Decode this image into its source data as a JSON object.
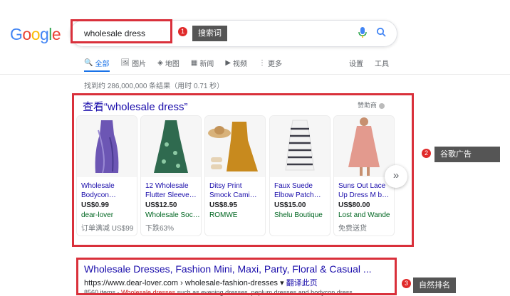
{
  "logo": [
    "G",
    "o",
    "o",
    "g",
    "l",
    "e"
  ],
  "search": {
    "query": "wholesale dress"
  },
  "annotations": {
    "search_term": "搜索词",
    "google_ads": "谷歌广告",
    "organic": "自然排名",
    "n1": "1",
    "n2": "2",
    "n3": "3"
  },
  "tabs": [
    {
      "label": "全部",
      "icon": "🔍"
    },
    {
      "label": "图片",
      "icon": "🖼"
    },
    {
      "label": "地图",
      "icon": "◈"
    },
    {
      "label": "新闻",
      "icon": "▦"
    },
    {
      "label": "视频",
      "icon": "▶"
    },
    {
      "label": "更多",
      "icon": "⋮"
    }
  ],
  "tools": {
    "settings": "设置",
    "tools": "工具"
  },
  "stats": "找到约 286,000,000 条结果（用时 0.71 秒）",
  "ads": {
    "title": "查看“wholesale dress”",
    "sponsor": "赞助商",
    "products": [
      {
        "line1": "Wholesale",
        "line2": "Bodycon…",
        "price": "US$0.99",
        "store": "dear-lover",
        "extra": "订单满减 US$99",
        "color": "#6c56b4"
      },
      {
        "line1": "12 Wholesale",
        "line2": "Flutter Sleeve…",
        "price": "US$12.50",
        "store": "Wholesale Soc…",
        "extra": "下跌63%",
        "color": "#2f6a4f"
      },
      {
        "line1": "Ditsy Print",
        "line2": "Smock Cami…",
        "price": "US$8.95",
        "store": "ROMWE",
        "extra": "",
        "color": "#c88a1e"
      },
      {
        "line1": "Faux Suede",
        "line2": "Elbow Patch…",
        "price": "US$15.00",
        "store": "Shelu Boutique",
        "extra": "",
        "color": "#3b3b46"
      },
      {
        "line1": "Suns Out Lace",
        "line2": "Up Dress M b…",
        "price": "US$80.00",
        "store": "Lost and Wande",
        "extra": "免费送货",
        "color": "#e39a8e"
      }
    ]
  },
  "result": {
    "title": "Wholesale Dresses, Fashion Mini, Maxi, Party, Floral & Casual ...",
    "url": "https://www.dear-lover.com › wholesale-fashion-dresses ▾ ",
    "translate": "翻译此页",
    "snippet_pre": "8560 items - ",
    "snippet_hl": "Wholesale dresses",
    "snippet_post": " such as evening dresses, peplum dresses and bodycon dress."
  }
}
